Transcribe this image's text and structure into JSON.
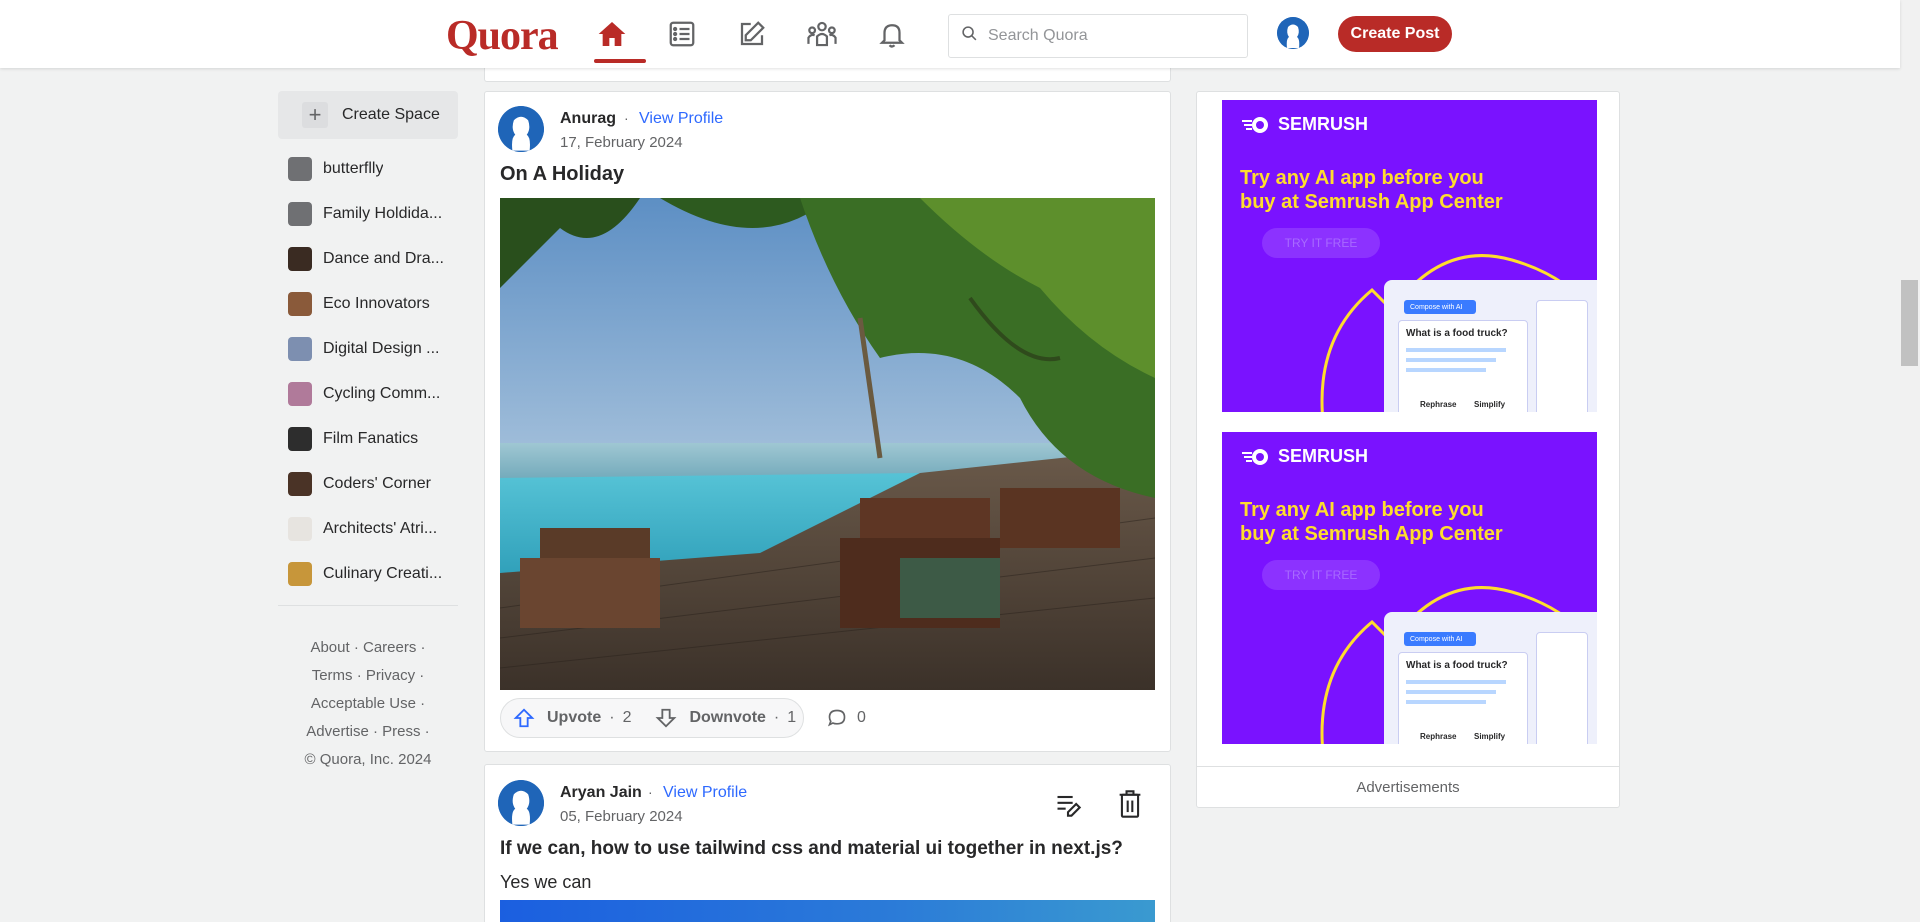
{
  "header": {
    "logo": "Quora",
    "nav": [
      {
        "name": "home-icon",
        "active": true
      },
      {
        "name": "following-icon",
        "active": false
      },
      {
        "name": "answer-icon",
        "active": false
      },
      {
        "name": "spaces-icon",
        "active": false
      },
      {
        "name": "notifications-icon",
        "active": false
      }
    ],
    "search_placeholder": "Search Quora",
    "create_post_label": "Create Post",
    "accent_color": "#b92b27"
  },
  "sidebar": {
    "create_space_label": "Create Space",
    "spaces": [
      {
        "label": "butterflly",
        "color": "#6f7073"
      },
      {
        "label": "Family Holdida...",
        "color": "#6f7073"
      },
      {
        "label": "Dance and Dra...",
        "color": "#3a2b22"
      },
      {
        "label": "Eco Innovators",
        "color": "#8a5a3a"
      },
      {
        "label": "Digital Design ...",
        "color": "#7d8fb0"
      },
      {
        "label": "Cycling Comm...",
        "color": "#b07a9a"
      },
      {
        "label": "Film Fanatics",
        "color": "#2d2d2d"
      },
      {
        "label": "Coders' Corner",
        "color": "#4a3326"
      },
      {
        "label": "Architects' Atri...",
        "color": "#e7e4e0"
      },
      {
        "label": "Culinary Creati...",
        "color": "#c7963a"
      }
    ],
    "footer": {
      "line1": [
        "About",
        "Careers"
      ],
      "line2": [
        "Terms",
        "Privacy"
      ],
      "line3": [
        "Acceptable Use"
      ],
      "line4": [
        "Advertise",
        "Press"
      ],
      "copyright": "© Quora, Inc. 2024"
    }
  },
  "posts": [
    {
      "author": "Anurag",
      "view_profile": "View Profile",
      "date": "17, February 2024",
      "title": "On A Holiday",
      "upvote_label": "Upvote",
      "upvotes": "2",
      "downvote_label": "Downvote",
      "downvotes": "1",
      "comments": "0"
    },
    {
      "author": "Aryan Jain",
      "view_profile": "View Profile",
      "date": "05, February 2024",
      "title": "If we can, how to use tailwind css and material ui together in next.js?",
      "body": "Yes we can"
    }
  ],
  "ads": {
    "items": [
      {
        "brand": "SEMRUSH",
        "headline_line1": "Try any AI app before you",
        "headline_line2": "buy at Semrush App Center",
        "cta": "TRY IT FREE",
        "mock_title": "What is a food truck?",
        "mock_btn1": "Rephrase",
        "mock_btn2": "Simplify",
        "mock_tag": "Compose with AI"
      },
      {
        "brand": "SEMRUSH",
        "headline_line1": "Try any AI app before you",
        "headline_line2": "buy at Semrush App Center",
        "cta": "TRY IT FREE",
        "mock_title": "What is a food truck?",
        "mock_btn1": "Rephrase",
        "mock_btn2": "Simplify",
        "mock_tag": "Compose with AI"
      }
    ],
    "label": "Advertisements"
  }
}
